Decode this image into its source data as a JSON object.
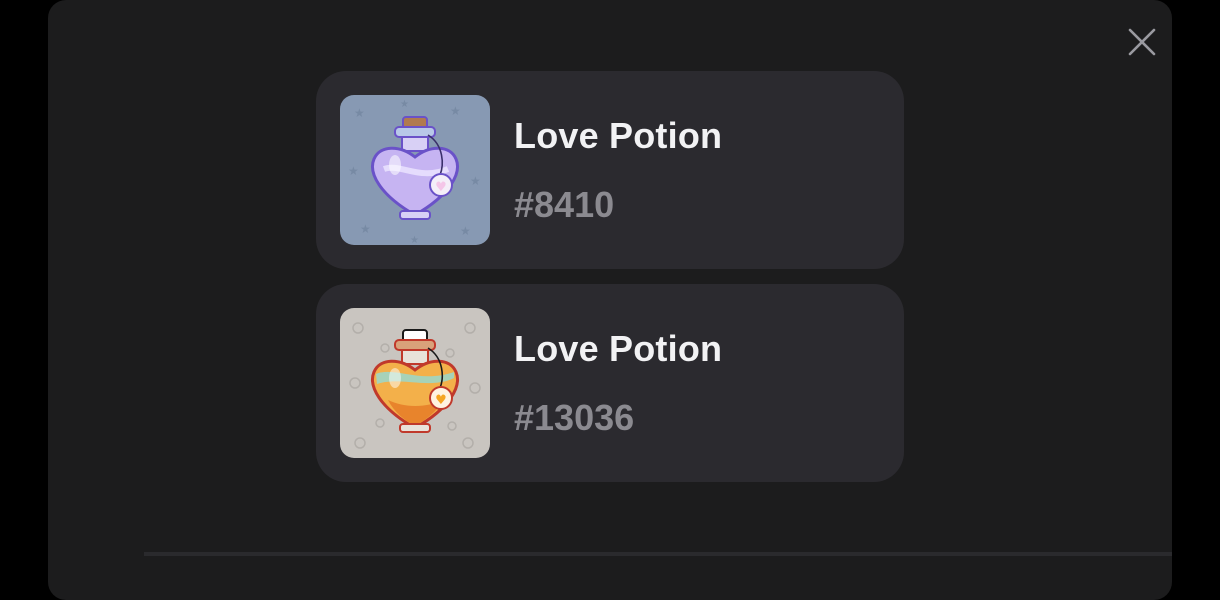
{
  "modal": {
    "close_icon": "close-icon",
    "items": [
      {
        "name": "Love Potion",
        "number": "#8410",
        "variant": "purple",
        "background": "#8b9cb3",
        "liquid": "#c9b6f2",
        "outline": "#6a52c8",
        "tag_heart": "#f4c6e8",
        "cork": "#b07a4f"
      },
      {
        "name": "Love Potion",
        "number": "#13036",
        "variant": "orange",
        "background": "#c9c5c0",
        "liquid": "#f2a23a",
        "outline": "#c0392b",
        "tag_heart": "#f5a623",
        "cork": "#ffffff"
      }
    ]
  }
}
